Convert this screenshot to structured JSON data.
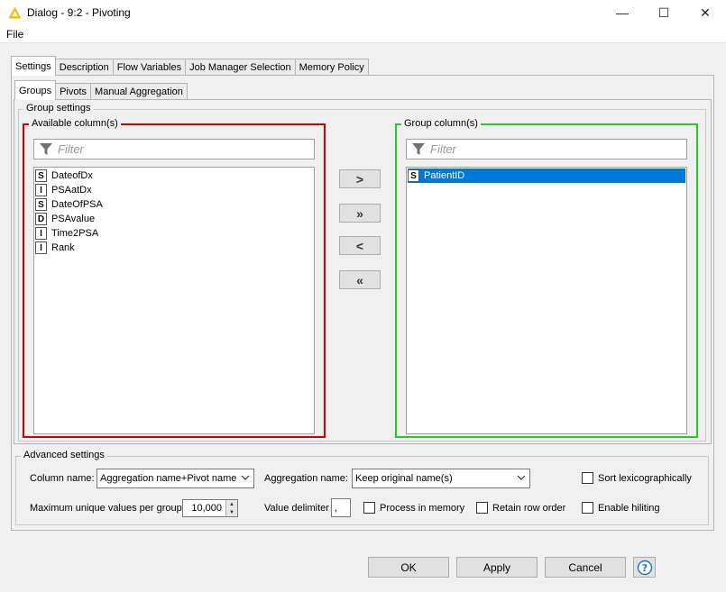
{
  "window": {
    "title": "Dialog - 9:2 - Pivoting",
    "minimize": "—",
    "maximize": "☐",
    "close": "✕",
    "icon": "warning-triangle-icon",
    "icon_color": "#f2c200"
  },
  "menu": {
    "file": "File"
  },
  "main_tabs": [
    {
      "label": "Settings",
      "active": true
    },
    {
      "label": "Description"
    },
    {
      "label": "Flow Variables"
    },
    {
      "label": "Job Manager Selection"
    },
    {
      "label": "Memory Policy"
    }
  ],
  "sub_tabs": [
    {
      "label": "Groups",
      "active": true
    },
    {
      "label": "Pivots"
    },
    {
      "label": "Manual Aggregation"
    }
  ],
  "group_settings": {
    "legend": "Group settings",
    "available": {
      "legend": "Available column(s)",
      "border_color": "#d40000",
      "filter_placeholder": "Filter",
      "items": [
        {
          "type": "S",
          "name": "DateofDx"
        },
        {
          "type": "I",
          "name": "PSAatDx"
        },
        {
          "type": "S",
          "name": "DateOfPSA"
        },
        {
          "type": "D",
          "name": "PSAvalue"
        },
        {
          "type": "I",
          "name": "Time2PSA"
        },
        {
          "type": "I",
          "name": "Rank"
        }
      ]
    },
    "group": {
      "legend": "Group column(s)",
      "border_color": "#22cc22",
      "filter_placeholder": "Filter",
      "items": [
        {
          "type": "S",
          "name": "PatientID",
          "selected": true
        }
      ]
    },
    "buttons": {
      "add": ">",
      "add_all": "»",
      "remove": "<",
      "remove_all": "«"
    }
  },
  "advanced": {
    "legend": "Advanced settings",
    "column_name_label": "Column name:",
    "column_name_value": "Aggregation name+Pivot name",
    "aggregation_name_label": "Aggregation name:",
    "aggregation_name_value": "Keep original name(s)",
    "sort_label": "Sort lexicographically",
    "max_unique_label": "Maximum unique values per group",
    "max_unique_value": "10,000",
    "delimiter_label": "Value delimiter",
    "delimiter_value": ",",
    "process_memory_label": "Process in memory",
    "retain_order_label": "Retain row order",
    "hiliting_label": "Enable hiliting"
  },
  "footer": {
    "ok": "OK",
    "apply": "Apply",
    "cancel": "Cancel",
    "help_icon": "help-icon"
  },
  "colors": {
    "selected": "#0078d7",
    "help_blue": "#1a73c8"
  }
}
